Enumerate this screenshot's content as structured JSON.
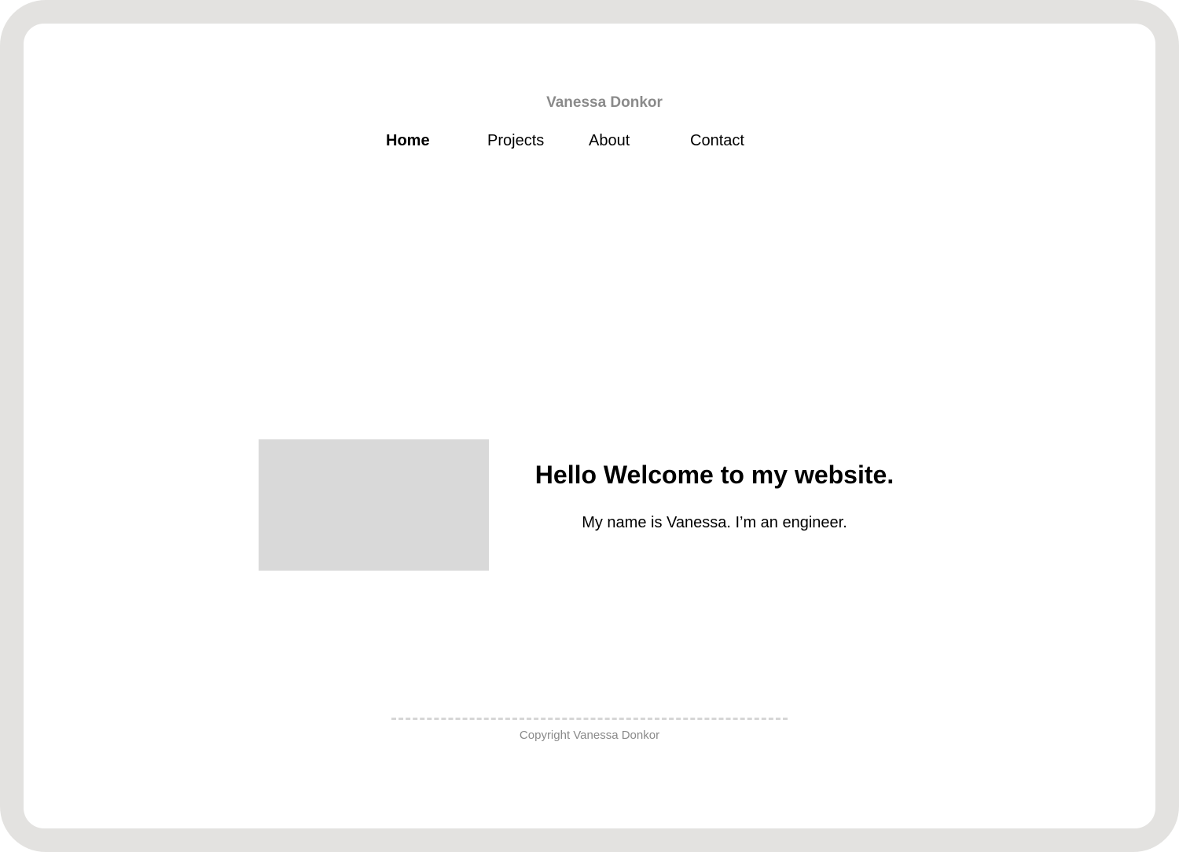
{
  "header": {
    "site_name": "Vanessa Donkor"
  },
  "nav": {
    "items": [
      {
        "label": "Home",
        "active": true
      },
      {
        "label": "Projects",
        "active": false
      },
      {
        "label": "About",
        "active": false
      },
      {
        "label": "Contact",
        "active": false
      }
    ]
  },
  "hero": {
    "title": "Hello Welcome to my website.",
    "subtitle": "My name is Vanessa. I’m an engineer."
  },
  "footer": {
    "copyright": "Copyright Vanessa Donkor"
  },
  "colors": {
    "frame": "#e3e2e0",
    "muted_text": "#8a8a8a",
    "image_placeholder": "#d9d9d9"
  }
}
